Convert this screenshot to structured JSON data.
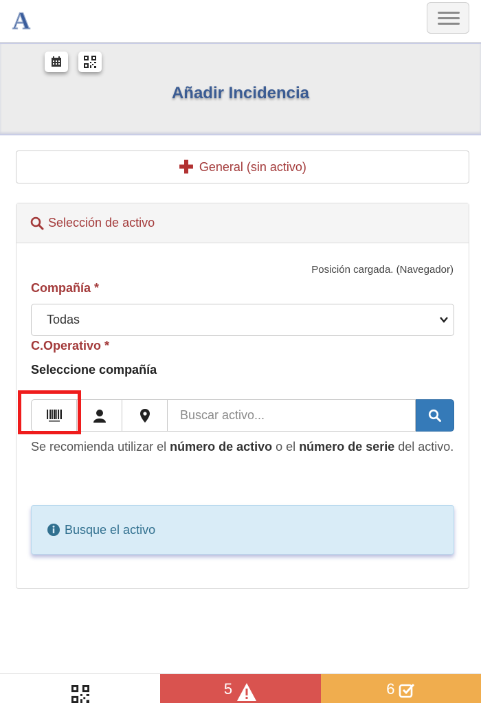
{
  "header": {
    "logo_letter": "A",
    "menu_icon": "hamburger-icon"
  },
  "title_band": {
    "calendar_icon": "calendar-icon",
    "qr_icon": "qr-code-icon",
    "title": "Añadir Incidencia"
  },
  "general_button": {
    "icon": "plus-icon",
    "label": "General (sin activo)"
  },
  "panel": {
    "title": "Selección de activo",
    "title_icon": "search-icon",
    "position_note": "Posición cargada. (Navegador)",
    "company_label": "Compañía *",
    "company_value": "Todas",
    "operative_label": "C.Operativo *",
    "operative_value": "Seleccione compañía",
    "search_placeholder": "Buscar activo...",
    "help_prefix": "Se recomienda utilizar el ",
    "help_bold1": "número de activo",
    "help_middle": " o el ",
    "help_bold2": "número de serie",
    "help_suffix": " del activo.",
    "alert_text": "Busque el activo"
  },
  "bottom_tabs": [
    {
      "label": "",
      "icon": "qr-code-icon",
      "color": "#ffffff"
    },
    {
      "label": "5",
      "icon": "warning-icon",
      "color": "#d9534f"
    },
    {
      "label": "6",
      "icon": "check-square-icon",
      "color": "#f0ad4e"
    }
  ],
  "colors": {
    "accent_red": "#a33a3a",
    "primary_blue": "#357ab8",
    "title_blue": "#3b5c93",
    "highlight": "#ef1c1c"
  }
}
